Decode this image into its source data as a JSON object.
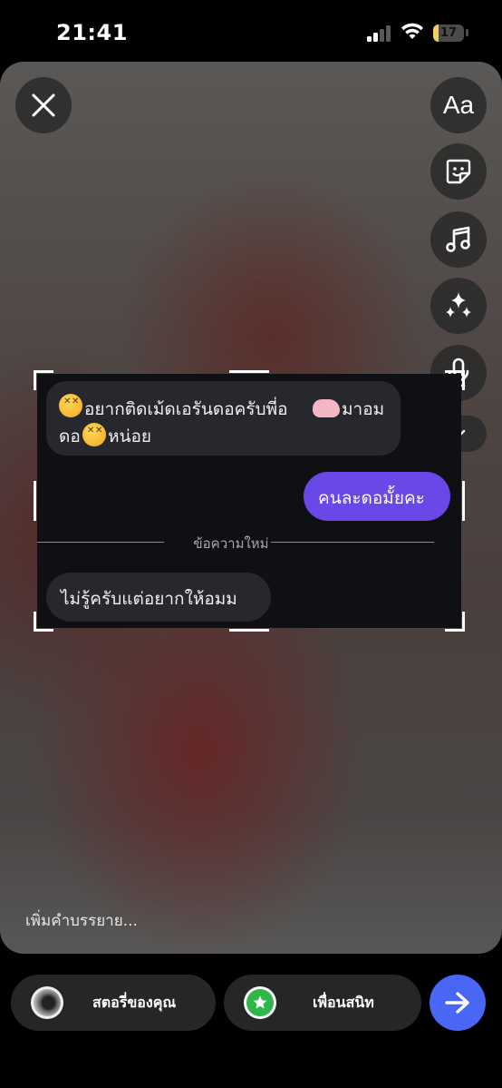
{
  "status_bar": {
    "time": "21:41",
    "battery_percent": "17",
    "battery_level": 0.17,
    "signal_bars_active": 2,
    "signal_bars_total": 4
  },
  "editor": {
    "close_icon": "close-icon",
    "text_tool_label": "Aa",
    "tools": [
      "text-tool",
      "sticker-icon",
      "music-icon",
      "sparkles-icon",
      "microphone-icon",
      "chevron-down-icon"
    ],
    "caption_placeholder": "เพิ่มคำบรรยาย..."
  },
  "chat": {
    "messages": [
      {
        "side": "left",
        "line1": "อยากติดเม้ดเอรันดอครับพี่อ",
        "line1_end": "มาอม",
        "line2_start": "ดอ",
        "line2_end": "หน่อย"
      },
      {
        "side": "right",
        "text": "คนละดอมั้ยคะ"
      },
      {
        "side": "left",
        "text": "ไม่รู้ครับแต่อยากให้อมม"
      }
    ],
    "new_messages_divider": "ข้อความใหม่"
  },
  "share": {
    "your_story_label": "สตอรี่ของคุณ",
    "close_friends_label": "เพื่อนสนิท",
    "send_icon": "arrow-right-icon"
  },
  "colors": {
    "send_button": "#4a66f5",
    "sent_bubble": "#6a48e8",
    "received_bubble": "#26282e",
    "close_friends_badge": "#2fb84a"
  }
}
